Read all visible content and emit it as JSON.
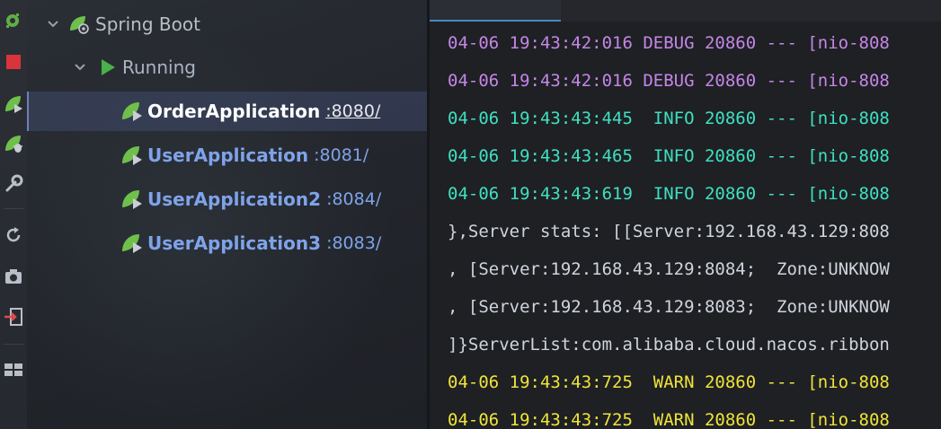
{
  "colors": {
    "debug": "#c586e6",
    "info": "#3fe0c1",
    "warn": "#f0e33a",
    "plain": "#d0d4dc",
    "spring_green": "#6fbf4b",
    "run_green": "#49b04a",
    "link_blue": "#7fa3ea"
  },
  "toolbar": {
    "icons": [
      "services-settings-icon",
      "stop-icon",
      "run-spring-icon",
      "debug-spring-icon",
      "wrench-icon",
      "refresh-icon",
      "camera-icon",
      "login-icon",
      "layout-icon"
    ]
  },
  "tree": {
    "root_label": "Spring Boot",
    "group_label": "Running",
    "apps": [
      {
        "name": "OrderApplication",
        "port": ":8080/",
        "selected": true
      },
      {
        "name": "UserApplication",
        "port": ":8081/",
        "selected": false
      },
      {
        "name": "UserApplication2",
        "port": ":8084/",
        "selected": false
      },
      {
        "name": "UserApplication3",
        "port": ":8083/",
        "selected": false
      }
    ]
  },
  "console": {
    "lines": [
      {
        "text": "04-06 19:43:42:016 DEBUG 20860 --- [nio-808",
        "level": "debug"
      },
      {
        "text": "04-06 19:43:42:016 DEBUG 20860 --- [nio-808",
        "level": "debug"
      },
      {
        "text": "04-06 19:43:43:445  INFO 20860 --- [nio-808",
        "level": "info"
      },
      {
        "text": "04-06 19:43:43:465  INFO 20860 --- [nio-808",
        "level": "info"
      },
      {
        "text": "04-06 19:43:43:619  INFO 20860 --- [nio-808",
        "level": "info"
      },
      {
        "text": "},Server stats: [[Server:192.168.43.129:808",
        "level": "plain"
      },
      {
        "text": ", [Server:192.168.43.129:8084;  Zone:UNKNOW",
        "level": "plain"
      },
      {
        "text": ", [Server:192.168.43.129:8083;  Zone:UNKNOW",
        "level": "plain"
      },
      {
        "text": "]}ServerList:com.alibaba.cloud.nacos.ribbon",
        "level": "plain"
      },
      {
        "text": "04-06 19:43:43:725  WARN 20860 --- [nio-808",
        "level": "warn"
      },
      {
        "text": "04-06 19:43:43:725  WARN 20860 --- [nio-808",
        "level": "warn"
      }
    ]
  }
}
